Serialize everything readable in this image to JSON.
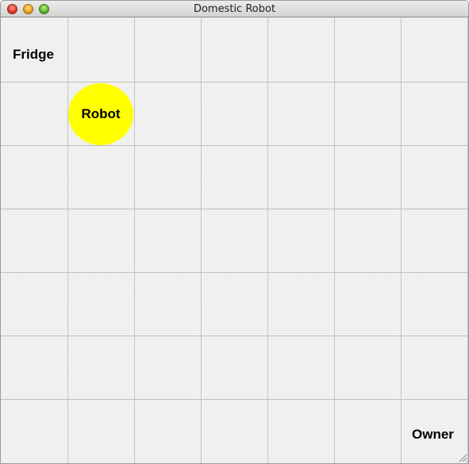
{
  "window": {
    "title": "Domestic Robot"
  },
  "grid": {
    "columns": 7,
    "rows": 7
  },
  "agents": {
    "fridge": {
      "label": "Fridge",
      "column": 1,
      "row": 1
    },
    "robot": {
      "label": "Robot",
      "column": 2,
      "row": 2,
      "color": "#ffff00"
    },
    "owner": {
      "label": "Owner",
      "column": 7,
      "row": 7
    }
  },
  "colors": {
    "grid_line": "#c3c3c3",
    "background": "#efefef",
    "robot_fill": "#ffff00"
  }
}
